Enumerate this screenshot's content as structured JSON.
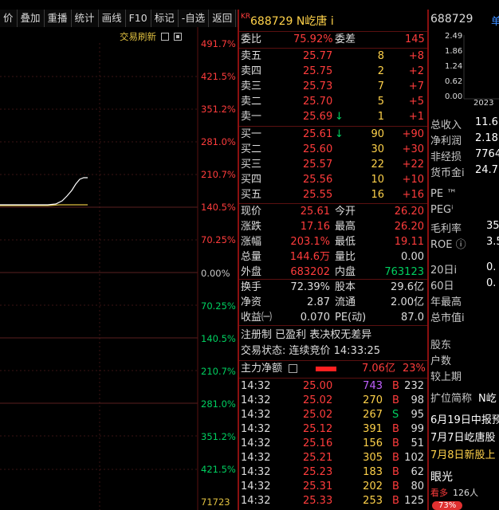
{
  "toolbar": [
    {
      "label": "价"
    },
    {
      "label": "叠加"
    },
    {
      "label": "重播"
    },
    {
      "label": "统计"
    },
    {
      "label": "画线"
    },
    {
      "label": "F10"
    },
    {
      "label": "标记"
    },
    {
      "label": "-自选"
    },
    {
      "label": "返回"
    }
  ],
  "chart": {
    "refresh_label": "交易刷新",
    "price_ticks_up": [
      "491.7%",
      "421.5%",
      "351.2%",
      "281.0%",
      "210.7%",
      "140.5%",
      "70.25%"
    ],
    "zero_tick": "0.00%",
    "price_ticks_down": [
      "70.25%",
      "140.5%",
      "210.7%",
      "281.0%",
      "351.2%",
      "421.5%"
    ],
    "volume_tick": "71723",
    "colors": {
      "line": "#ffffff",
      "avg": "#e0c040",
      "grid": "#3a1515"
    }
  },
  "quote": {
    "kr": "KR",
    "title": "688729 N屹唐 i",
    "weibi_label": "委比",
    "weibi": "75.92%",
    "weicha_label": "委差",
    "weicha": "145",
    "asks": [
      {
        "label": "卖五",
        "price": "25.77",
        "vol": "8",
        "chg": "+8",
        "arrow": ""
      },
      {
        "label": "卖四",
        "price": "25.75",
        "vol": "2",
        "chg": "+2",
        "arrow": ""
      },
      {
        "label": "卖三",
        "price": "25.73",
        "vol": "7",
        "chg": "+7",
        "arrow": ""
      },
      {
        "label": "卖二",
        "price": "25.70",
        "vol": "5",
        "chg": "+5",
        "arrow": ""
      },
      {
        "label": "卖一",
        "price": "25.69",
        "vol": "1",
        "chg": "+1",
        "arrow": "↓"
      }
    ],
    "bids": [
      {
        "label": "买一",
        "price": "25.61",
        "vol": "90",
        "chg": "+90",
        "arrow": "↓"
      },
      {
        "label": "买二",
        "price": "25.60",
        "vol": "30",
        "chg": "+30",
        "arrow": ""
      },
      {
        "label": "买三",
        "price": "25.57",
        "vol": "22",
        "chg": "+22",
        "arrow": ""
      },
      {
        "label": "买四",
        "price": "25.56",
        "vol": "10",
        "chg": "+10",
        "arrow": ""
      },
      {
        "label": "买五",
        "price": "25.55",
        "vol": "16",
        "chg": "+16",
        "arrow": ""
      }
    ],
    "stats1": [
      {
        "l1": "现价",
        "v1": "25.61",
        "l2": "今开",
        "v2": "26.20"
      },
      {
        "l1": "涨跌",
        "v1": "17.16",
        "l2": "最高",
        "v2": "26.20"
      },
      {
        "l1": "涨幅",
        "v1": "203.1%",
        "l2": "最低",
        "v2": "19.11"
      },
      {
        "l1": "总量",
        "v1": "144.6万",
        "l2": "量比",
        "v2": "0.00"
      },
      {
        "l1": "外盘",
        "v1": "683202",
        "l2": "内盘",
        "v2": "763123"
      }
    ],
    "stats2": [
      {
        "l1": "换手",
        "v1": "72.39%",
        "l2": "股本",
        "v2": "29.6亿"
      },
      {
        "l1": "净资",
        "v1": "2.87",
        "l2": "流通",
        "v2": "2.00亿"
      },
      {
        "l1": "收益㈠",
        "v1": "0.070",
        "l2": "PE(动)",
        "v2": "87.0"
      }
    ],
    "tags": "注册制 已盈利 表决权无差异",
    "status": "交易状态: 连续竞价 14:33:25",
    "net_label": "主力净额",
    "net_value": "7.06亿",
    "net_pct": "23%",
    "ticks": [
      {
        "time": "14:32",
        "price": "25.00",
        "vol": "743",
        "side": "B",
        "n": "232",
        "vol_color": "purple"
      },
      {
        "time": "14:32",
        "price": "25.02",
        "vol": "270",
        "side": "B",
        "n": "98",
        "vol_color": "yellow"
      },
      {
        "time": "14:32",
        "price": "25.02",
        "vol": "267",
        "side": "S",
        "n": "95",
        "vol_color": "yellow"
      },
      {
        "time": "14:32",
        "price": "25.12",
        "vol": "391",
        "side": "B",
        "n": "99",
        "vol_color": "yellow"
      },
      {
        "time": "14:32",
        "price": "25.16",
        "vol": "156",
        "side": "B",
        "n": "51",
        "vol_color": "yellow"
      },
      {
        "time": "14:32",
        "price": "25.21",
        "vol": "305",
        "side": "B",
        "n": "102",
        "vol_color": "yellow"
      },
      {
        "time": "14:32",
        "price": "25.23",
        "vol": "183",
        "side": "B",
        "n": "62",
        "vol_color": "yellow"
      },
      {
        "time": "14:32",
        "price": "25.31",
        "vol": "202",
        "side": "B",
        "n": "80",
        "vol_color": "yellow"
      },
      {
        "time": "14:32",
        "price": "25.33",
        "vol": "253",
        "side": "B",
        "n": "125",
        "vol_color": "yellow"
      }
    ]
  },
  "side": {
    "code": "688729",
    "unit": "单",
    "mini_ticks": [
      "2.49",
      "1.86",
      "1.24",
      "0.62",
      "0.00"
    ],
    "year": "2023",
    "items1": [
      {
        "label": "总收入",
        "value": "11.6"
      },
      {
        "label": "净利润",
        "value": "2.18"
      },
      {
        "label": "非经损",
        "value": "7764"
      },
      {
        "label": "货币金i",
        "value": "24.7"
      }
    ],
    "items2": [
      {
        "label": "PE ™",
        "value": ""
      },
      {
        "label": "PEGⁱ",
        "value": ""
      },
      {
        "label": "毛利率",
        "value": "35"
      },
      {
        "label": "ROE ⓘ",
        "value": "3.5"
      }
    ],
    "items3": [
      {
        "label": "20日i",
        "value": "0."
      },
      {
        "label": "60日",
        "value": "0."
      },
      {
        "label": "年最高",
        "value": ""
      },
      {
        "label": "总市值i",
        "value": ""
      }
    ],
    "items4": [
      "股东",
      "户数",
      "较上期"
    ],
    "abbr_label": "扩位简称",
    "abbr_value": "N屹",
    "news": [
      "6月19日中报预",
      "7月7日屹唐股",
      "7月8日新股上"
    ],
    "bottom_label": "眼光",
    "bottom_sub": "看多",
    "bottom_count": "126人",
    "bottom_pct": "73%"
  }
}
